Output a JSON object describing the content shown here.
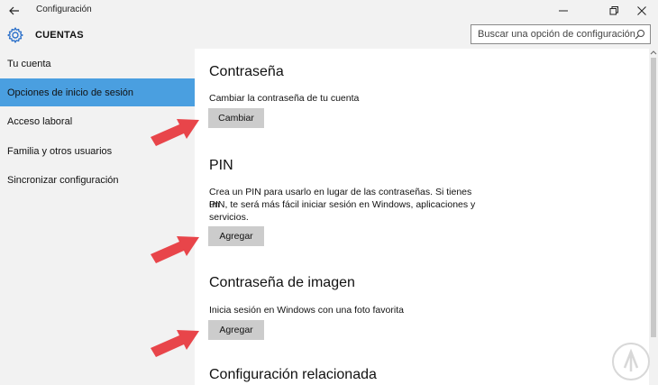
{
  "window": {
    "title": "Configuración"
  },
  "header": {
    "section_title": "CUENTAS",
    "search_placeholder": "Buscar una opción de configuración"
  },
  "sidebar": {
    "items": [
      {
        "label": "Tu cuenta",
        "selected": false
      },
      {
        "label": "Opciones de inicio de sesión",
        "selected": true
      },
      {
        "label": "Acceso laboral",
        "selected": false
      },
      {
        "label": "Familia y otros usuarios",
        "selected": false
      },
      {
        "label": "Sincronizar configuración",
        "selected": false
      }
    ]
  },
  "main": {
    "password": {
      "heading": "Contraseña",
      "description": "Cambiar la contraseña de tu cuenta",
      "button": "Cambiar"
    },
    "pin": {
      "heading": "PIN",
      "description_lines": [
        "Crea un PIN para usarlo en lugar de las contraseñas. Si tienes un",
        "PIN, te será más fácil iniciar sesión en Windows, aplicaciones y",
        "servicios."
      ],
      "button": "Agregar"
    },
    "picture_password": {
      "heading": "Contraseña de imagen",
      "description": "Inicia sesión en Windows con una foto favorita",
      "button": "Agregar"
    },
    "related": {
      "heading": "Configuración relacionada"
    }
  },
  "colors": {
    "selected_nav": "#4a9fe0",
    "sidebar_bg": "#f2f2f2",
    "button_bg": "#cccccc",
    "annotation_arrow": "#e8454a"
  }
}
